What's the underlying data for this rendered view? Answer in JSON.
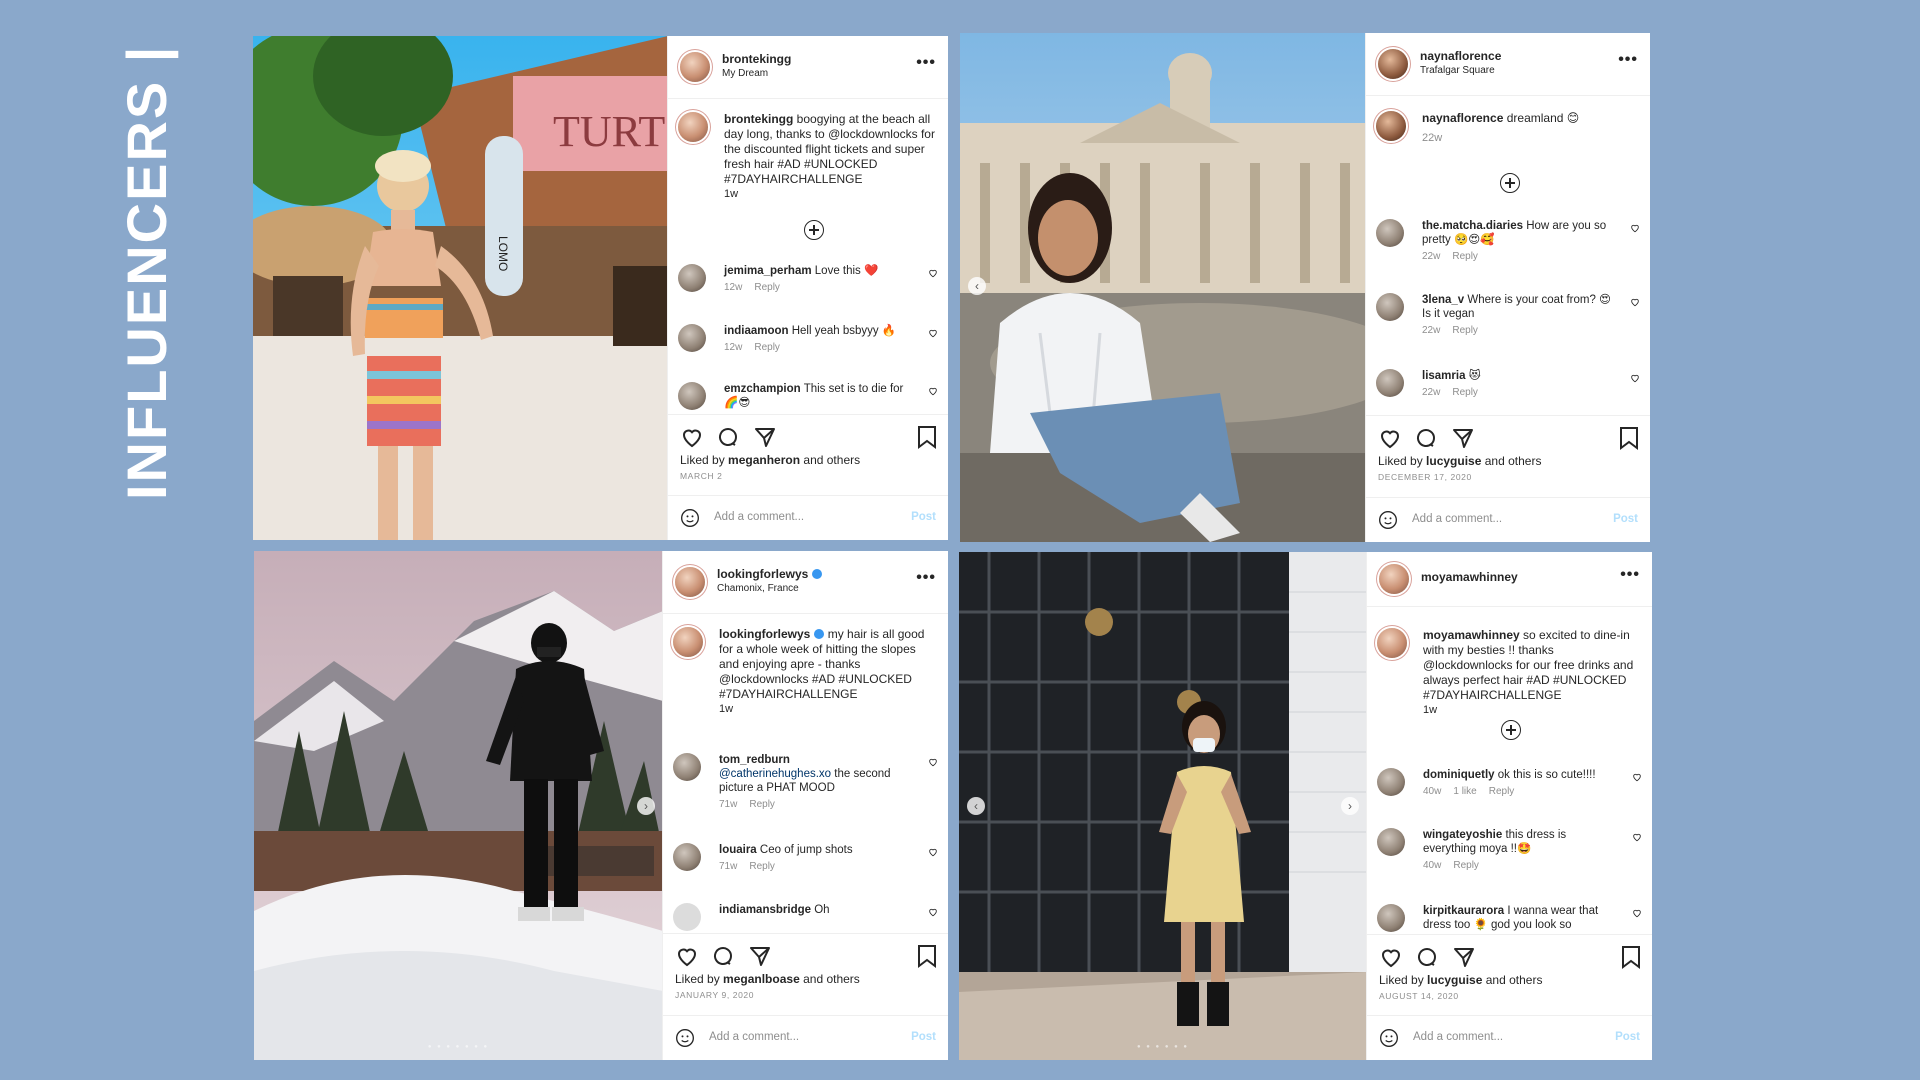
{
  "slide_title": "INFLUENCERS |",
  "post_action_labels": {
    "add_comment": "Add a comment...",
    "post": "Post",
    "reply": "Reply",
    "liked_by_prefix": "Liked by",
    "and_others": "and others"
  },
  "posts": [
    {
      "username": "brontekingg",
      "location": "My Dream",
      "verified": false,
      "caption_user": "brontekingg",
      "caption": "boogying at the beach all day long, thanks to @lockdownlocks for the discounted flight tickets and super fresh hair #AD #UNLOCKED #7DAYHAIRCHALLENGE",
      "caption_time": "1w",
      "comments": [
        {
          "user": "jemima_perham",
          "text": "Love this ❤️",
          "time": "12w",
          "likes": ""
        },
        {
          "user": "indiaamoon",
          "text": "Hell yeah bsbyyy 🔥",
          "time": "12w",
          "likes": ""
        },
        {
          "user": "emzchampion",
          "text": "This set is to die for 🌈😎",
          "time": "",
          "likes": ""
        }
      ],
      "liked_by": "meganheron",
      "date": "MARCH 2"
    },
    {
      "username": "naynaflorence",
      "location": "Trafalgar Square",
      "verified": false,
      "caption_user": "naynaflorence",
      "caption": "dreamland 😊",
      "caption_time": "22w",
      "comments": [
        {
          "user": "the.matcha.diaries",
          "text": "How are you so pretty 🥺😍🥰",
          "time": "22w",
          "likes": ""
        },
        {
          "user": "3lena_v",
          "text": "Where is your coat from? 😍 Is it vegan",
          "time": "22w",
          "likes": ""
        },
        {
          "user": "lisamria",
          "text": "😻",
          "time": "22w",
          "likes": ""
        }
      ],
      "liked_by": "lucyguise",
      "date": "DECEMBER 17, 2020"
    },
    {
      "username": "lookingforlewys",
      "location": "Chamonix, France",
      "verified": true,
      "caption_user": "lookingforlewys",
      "caption": "my hair is all good for a whole week of hitting the slopes and enjoying apre - thanks @lockdownlocks #AD #UNLOCKED #7DAYHAIRCHALLENGE",
      "caption_time": "1w",
      "comments": [
        {
          "user": "tom_redburn",
          "mention": "@catherinehughes.xo",
          "text": "the second picture a PHAT MOOD",
          "time": "71w",
          "likes": ""
        },
        {
          "user": "louaira",
          "text": "Ceo of jump shots",
          "time": "71w",
          "likes": ""
        },
        {
          "user": "indiamansbridge",
          "text": "Oh",
          "time": "",
          "likes": ""
        }
      ],
      "liked_by": "meganlboase",
      "date": "JANUARY 9, 2020"
    },
    {
      "username": "moyamawhinney",
      "location": "",
      "verified": false,
      "caption_user": "moyamawhinney",
      "caption": "so excited to dine-in with my besties !! thanks @lockdownlocks for our free drinks and always perfect hair #AD #UNLOCKED #7DAYHAIRCHALLENGE",
      "caption_time": "1w",
      "comments": [
        {
          "user": "dominiquetly",
          "text": "ok this is so cute!!!!",
          "time": "40w",
          "likes": "1 like"
        },
        {
          "user": "wingateyoshie",
          "text": "this dress is everything moya !!🤩",
          "time": "40w",
          "likes": ""
        },
        {
          "user": "kirpitkaurarora",
          "text": "I wanna wear that dress too 🌻 god you look so",
          "time": "",
          "likes": ""
        }
      ],
      "liked_by": "lucyguise",
      "date": "AUGUST 14, 2020"
    }
  ],
  "photo_signs": {
    "beach_sign": "TURT",
    "surfboard": "LOMO"
  },
  "colors": {
    "background": "#8aa8cb",
    "post_button": "#b2dffc",
    "heart_red": "#ed4956"
  }
}
